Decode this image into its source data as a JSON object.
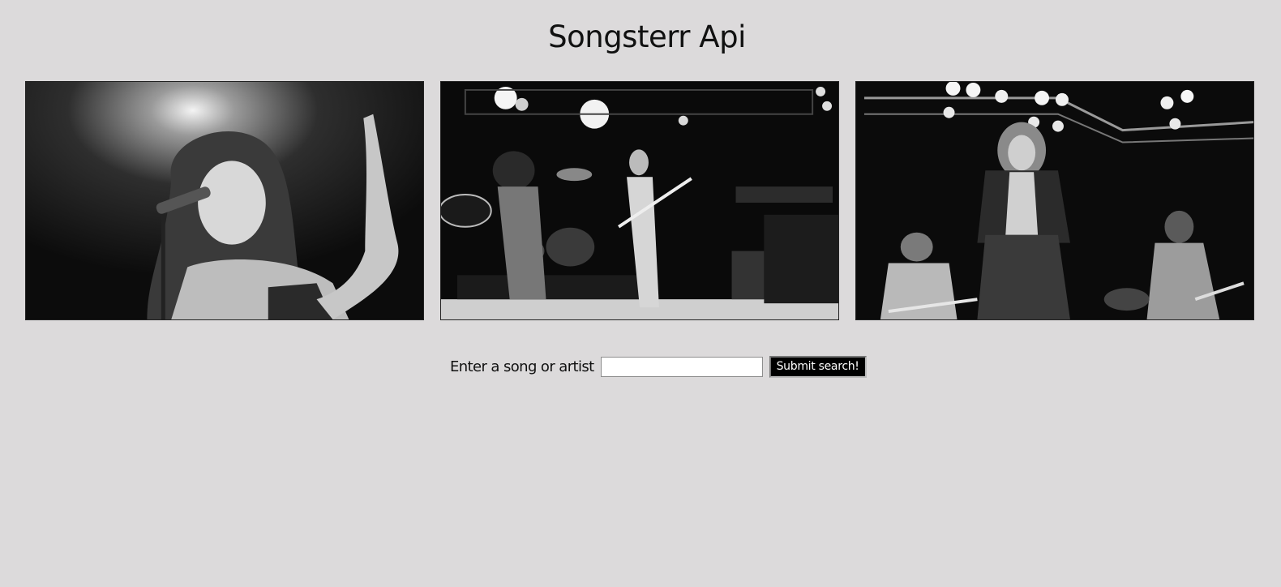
{
  "page": {
    "title": "Songsterr Api",
    "background": "#dcdadb"
  },
  "gallery": {
    "photos": [
      {
        "subject": "female singer at microphone under stage light"
      },
      {
        "subject": "band performing on stage with guitarists and drums"
      },
      {
        "subject": "rock singer with band under lighting rig"
      }
    ]
  },
  "search": {
    "label": "Enter a song or artist",
    "value": "",
    "placeholder": "",
    "submit_label": "Submit search!"
  }
}
